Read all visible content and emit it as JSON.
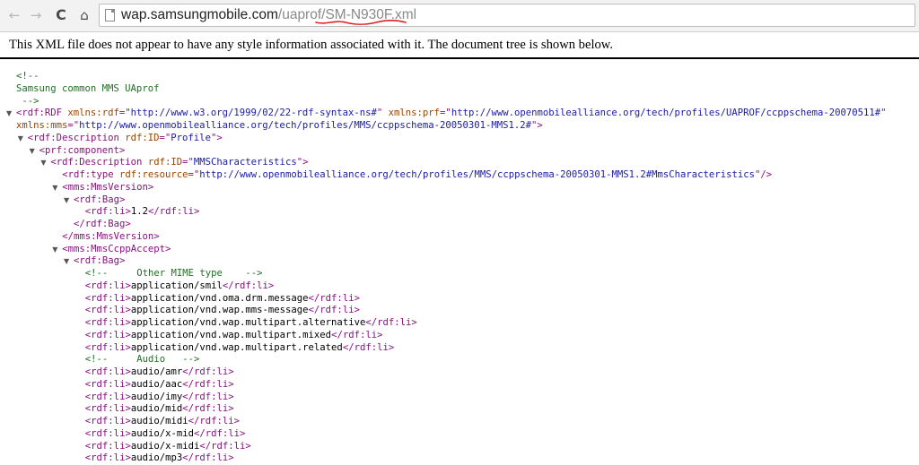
{
  "browser": {
    "back_glyph": "←",
    "forward_glyph": "→",
    "reload_glyph": "C",
    "home_glyph": "⌂",
    "url_host": "wap.samsungmobile.com",
    "url_path": "/uaprof/",
    "url_file": "SM-N930F.xml",
    "annotation_color": "#e02020"
  },
  "info_message": "This XML file does not appear to have any style information associated with it. The document tree is shown below.",
  "colors": {
    "tag": "#881280",
    "attribute_name": "#994500",
    "attribute_value": "#1a1aa6",
    "comment": "#236e25"
  },
  "toggle_glyph": "▼",
  "tree": [
    {
      "indent": 0,
      "toggle": false,
      "parts": [
        [
          "cmt",
          "<!--"
        ]
      ]
    },
    {
      "indent": 0,
      "toggle": false,
      "parts": [
        [
          "cmt",
          "Samsung common MMS UAprof"
        ]
      ]
    },
    {
      "indent": 0,
      "toggle": false,
      "parts": [
        [
          "cmt",
          " -->"
        ]
      ]
    },
    {
      "indent": 0,
      "toggle": true,
      "parts": [
        [
          "tag",
          "<rdf:RDF"
        ],
        [
          "plain",
          " "
        ],
        [
          "attr",
          "xmlns:rdf"
        ],
        [
          "tag",
          "=\""
        ],
        [
          "val",
          "http://www.w3.org/1999/02/22-rdf-syntax-ns#"
        ],
        [
          "tag",
          "\""
        ],
        [
          "plain",
          " "
        ],
        [
          "attr",
          "xmlns:prf"
        ],
        [
          "tag",
          "=\""
        ],
        [
          "val",
          "http://www.openmobilealliance.org/tech/profiles/UAPROF/ccppschema-20070511#"
        ],
        [
          "tag",
          "\""
        ]
      ]
    },
    {
      "indent": 0,
      "toggle": false,
      "parts": [
        [
          "attr",
          "xmlns:mms"
        ],
        [
          "tag",
          "=\""
        ],
        [
          "val",
          "http://www.openmobilealliance.org/tech/profiles/MMS/ccppschema-20050301-MMS1.2#"
        ],
        [
          "tag",
          "\">"
        ]
      ]
    },
    {
      "indent": 1,
      "toggle": true,
      "parts": [
        [
          "tag",
          "<rdf:Description"
        ],
        [
          "plain",
          " "
        ],
        [
          "attr",
          "rdf:ID"
        ],
        [
          "tag",
          "=\""
        ],
        [
          "val",
          "Profile"
        ],
        [
          "tag",
          "\">"
        ]
      ]
    },
    {
      "indent": 2,
      "toggle": true,
      "parts": [
        [
          "tag",
          "<prf:component>"
        ]
      ]
    },
    {
      "indent": 3,
      "toggle": true,
      "parts": [
        [
          "tag",
          "<rdf:Description"
        ],
        [
          "plain",
          " "
        ],
        [
          "attr",
          "rdf:ID"
        ],
        [
          "tag",
          "=\""
        ],
        [
          "val",
          "MMSCharacteristics"
        ],
        [
          "tag",
          "\">"
        ]
      ]
    },
    {
      "indent": 4,
      "toggle": false,
      "parts": [
        [
          "tag",
          "<rdf:type"
        ],
        [
          "plain",
          " "
        ],
        [
          "attr",
          "rdf:resource"
        ],
        [
          "tag",
          "=\""
        ],
        [
          "val",
          "http://www.openmobilealliance.org/tech/profiles/MMS/ccppschema-20050301-MMS1.2#MmsCharacteristics"
        ],
        [
          "tag",
          "\"/>"
        ]
      ]
    },
    {
      "indent": 4,
      "toggle": true,
      "parts": [
        [
          "tag",
          "<mms:MmsVersion>"
        ]
      ]
    },
    {
      "indent": 5,
      "toggle": true,
      "parts": [
        [
          "tag",
          "<rdf:Bag>"
        ]
      ]
    },
    {
      "indent": 6,
      "toggle": false,
      "parts": [
        [
          "tag",
          "<rdf:li>"
        ],
        [
          "plain",
          "1.2"
        ],
        [
          "tag",
          "</rdf:li>"
        ]
      ]
    },
    {
      "indent": 5,
      "toggle": false,
      "parts": [
        [
          "tag",
          "</rdf:Bag>"
        ]
      ]
    },
    {
      "indent": 4,
      "toggle": false,
      "parts": [
        [
          "tag",
          "</mms:MmsVersion>"
        ]
      ]
    },
    {
      "indent": 4,
      "toggle": true,
      "parts": [
        [
          "tag",
          "<mms:MmsCcppAccept>"
        ]
      ]
    },
    {
      "indent": 5,
      "toggle": true,
      "parts": [
        [
          "tag",
          "<rdf:Bag>"
        ]
      ]
    },
    {
      "indent": 6,
      "toggle": false,
      "parts": [
        [
          "cmt",
          "<!--     Other MIME type    -->"
        ]
      ]
    },
    {
      "indent": 6,
      "toggle": false,
      "parts": [
        [
          "tag",
          "<rdf:li>"
        ],
        [
          "plain",
          "application/smil"
        ],
        [
          "tag",
          "</rdf:li>"
        ]
      ]
    },
    {
      "indent": 6,
      "toggle": false,
      "parts": [
        [
          "tag",
          "<rdf:li>"
        ],
        [
          "plain",
          "application/vnd.oma.drm.message"
        ],
        [
          "tag",
          "</rdf:li>"
        ]
      ]
    },
    {
      "indent": 6,
      "toggle": false,
      "parts": [
        [
          "tag",
          "<rdf:li>"
        ],
        [
          "plain",
          "application/vnd.wap.mms-message"
        ],
        [
          "tag",
          "</rdf:li>"
        ]
      ]
    },
    {
      "indent": 6,
      "toggle": false,
      "parts": [
        [
          "tag",
          "<rdf:li>"
        ],
        [
          "plain",
          "application/vnd.wap.multipart.alternative"
        ],
        [
          "tag",
          "</rdf:li>"
        ]
      ]
    },
    {
      "indent": 6,
      "toggle": false,
      "parts": [
        [
          "tag",
          "<rdf:li>"
        ],
        [
          "plain",
          "application/vnd.wap.multipart.mixed"
        ],
        [
          "tag",
          "</rdf:li>"
        ]
      ]
    },
    {
      "indent": 6,
      "toggle": false,
      "parts": [
        [
          "tag",
          "<rdf:li>"
        ],
        [
          "plain",
          "application/vnd.wap.multipart.related"
        ],
        [
          "tag",
          "</rdf:li>"
        ]
      ]
    },
    {
      "indent": 6,
      "toggle": false,
      "parts": [
        [
          "cmt",
          "<!--     Audio   -->"
        ]
      ]
    },
    {
      "indent": 6,
      "toggle": false,
      "parts": [
        [
          "tag",
          "<rdf:li>"
        ],
        [
          "plain",
          "audio/amr"
        ],
        [
          "tag",
          "</rdf:li>"
        ]
      ]
    },
    {
      "indent": 6,
      "toggle": false,
      "parts": [
        [
          "tag",
          "<rdf:li>"
        ],
        [
          "plain",
          "audio/aac"
        ],
        [
          "tag",
          "</rdf:li>"
        ]
      ]
    },
    {
      "indent": 6,
      "toggle": false,
      "parts": [
        [
          "tag",
          "<rdf:li>"
        ],
        [
          "plain",
          "audio/imy"
        ],
        [
          "tag",
          "</rdf:li>"
        ]
      ]
    },
    {
      "indent": 6,
      "toggle": false,
      "parts": [
        [
          "tag",
          "<rdf:li>"
        ],
        [
          "plain",
          "audio/mid"
        ],
        [
          "tag",
          "</rdf:li>"
        ]
      ]
    },
    {
      "indent": 6,
      "toggle": false,
      "parts": [
        [
          "tag",
          "<rdf:li>"
        ],
        [
          "plain",
          "audio/midi"
        ],
        [
          "tag",
          "</rdf:li>"
        ]
      ]
    },
    {
      "indent": 6,
      "toggle": false,
      "parts": [
        [
          "tag",
          "<rdf:li>"
        ],
        [
          "plain",
          "audio/x-mid"
        ],
        [
          "tag",
          "</rdf:li>"
        ]
      ]
    },
    {
      "indent": 6,
      "toggle": false,
      "parts": [
        [
          "tag",
          "<rdf:li>"
        ],
        [
          "plain",
          "audio/x-midi"
        ],
        [
          "tag",
          "</rdf:li>"
        ]
      ]
    },
    {
      "indent": 6,
      "toggle": false,
      "parts": [
        [
          "tag",
          "<rdf:li>"
        ],
        [
          "plain",
          "audio/mp3"
        ],
        [
          "tag",
          "</rdf:li>"
        ]
      ]
    }
  ]
}
